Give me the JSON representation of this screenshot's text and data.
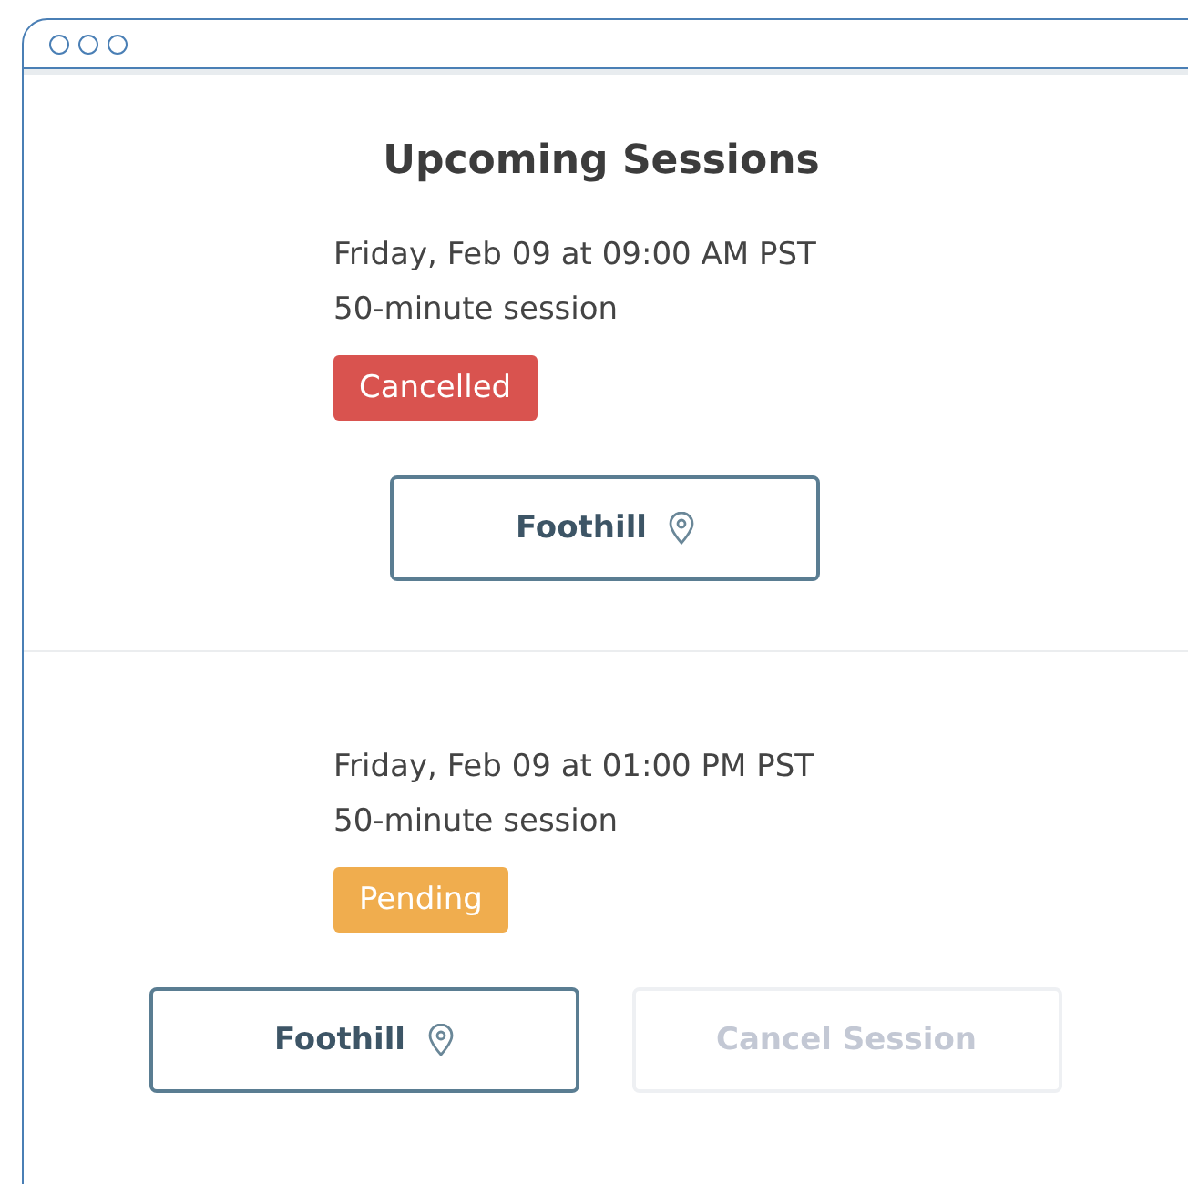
{
  "heading": "Upcoming Sessions",
  "sessions": [
    {
      "datetime": "Friday, Feb 09 at 09:00 AM PST",
      "duration": "50-minute session",
      "status": {
        "label": "Cancelled",
        "color": "#d9534f"
      },
      "buttons": [
        {
          "kind": "location",
          "label": "Foothill",
          "disabled": false
        }
      ]
    },
    {
      "datetime": "Friday, Feb 09 at 01:00 PM PST",
      "duration": "50-minute session",
      "status": {
        "label": "Pending",
        "color": "#f0ad4e"
      },
      "buttons": [
        {
          "kind": "location",
          "label": "Foothill",
          "disabled": false
        },
        {
          "kind": "cancel",
          "label": "Cancel Session",
          "disabled": true
        }
      ]
    }
  ]
}
